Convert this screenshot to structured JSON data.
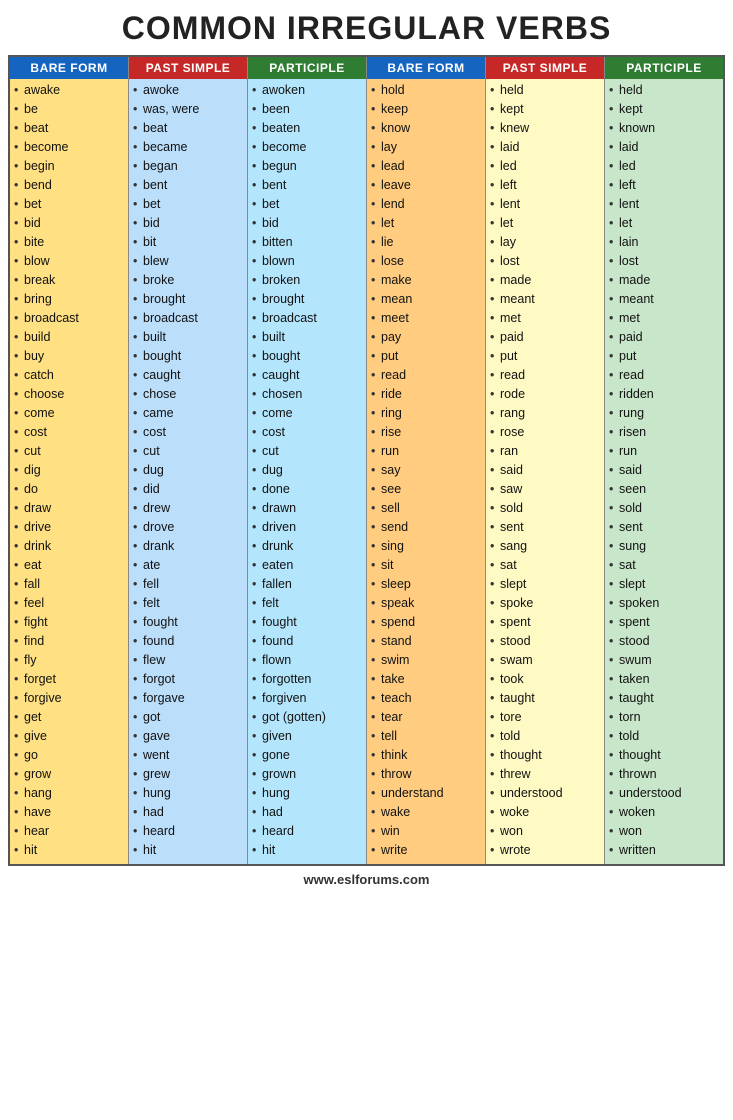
{
  "title": "COMMON IRREGULAR VERBS",
  "footer": "www.eslforums.com",
  "columns": [
    {
      "header": "BARE FORM",
      "headerClass": "blue",
      "bgClass": "bg-yellow",
      "items": [
        "awake",
        "be",
        "beat",
        "become",
        "begin",
        "bend",
        "bet",
        "bid",
        "bite",
        "blow",
        "break",
        "bring",
        "broadcast",
        "build",
        "buy",
        "catch",
        "choose",
        "come",
        "cost",
        "cut",
        "dig",
        "do",
        "draw",
        "drive",
        "drink",
        "eat",
        "fall",
        "feel",
        "fight",
        "find",
        "fly",
        "forget",
        "forgive",
        "get",
        "give",
        "go",
        "grow",
        "hang",
        "have",
        "hear",
        "hit"
      ]
    },
    {
      "header": "PAST SIMPLE",
      "headerClass": "red",
      "bgClass": "bg-blue",
      "items": [
        "awoke",
        "was, were",
        "beat",
        "became",
        "began",
        "bent",
        "bet",
        "bid",
        "bit",
        "blew",
        "broke",
        "brought",
        "broadcast",
        "built",
        "bought",
        "caught",
        "chose",
        "came",
        "cost",
        "cut",
        "dug",
        "did",
        "drew",
        "drove",
        "drank",
        "ate",
        "fell",
        "felt",
        "fought",
        "found",
        "flew",
        "forgot",
        "forgave",
        "got",
        "gave",
        "went",
        "grew",
        "hung",
        "had",
        "heard",
        "hit"
      ]
    },
    {
      "header": "PARTICIPLE",
      "headerClass": "green",
      "bgClass": "bg-lightblue",
      "items": [
        "awoken",
        "been",
        "beaten",
        "become",
        "begun",
        "bent",
        "bet",
        "bid",
        "bitten",
        "blown",
        "broken",
        "brought",
        "broadcast",
        "built",
        "bought",
        "caught",
        "chosen",
        "come",
        "cost",
        "cut",
        "dug",
        "done",
        "drawn",
        "driven",
        "drunk",
        "eaten",
        "fallen",
        "felt",
        "fought",
        "found",
        "flown",
        "forgotten",
        "forgiven",
        "got (gotten)",
        "given",
        "gone",
        "grown",
        "hung",
        "had",
        "heard",
        "hit"
      ]
    },
    {
      "header": "BARE FORM",
      "headerClass": "blue",
      "bgClass": "bg-orange",
      "items": [
        "hold",
        "keep",
        "know",
        "lay",
        "lead",
        "leave",
        "lend",
        "let",
        "lie",
        "lose",
        "make",
        "mean",
        "meet",
        "pay",
        "put",
        "read",
        "ride",
        "ring",
        "rise",
        "run",
        "say",
        "see",
        "sell",
        "send",
        "sing",
        "sit",
        "sleep",
        "speak",
        "spend",
        "stand",
        "swim",
        "take",
        "teach",
        "tear",
        "tell",
        "think",
        "throw",
        "understand",
        "wake",
        "win",
        "write"
      ]
    },
    {
      "header": "PAST SIMPLE",
      "headerClass": "red",
      "bgClass": "bg-lightyellow",
      "items": [
        "held",
        "kept",
        "knew",
        "laid",
        "led",
        "left",
        "lent",
        "let",
        "lay",
        "lost",
        "made",
        "meant",
        "met",
        "paid",
        "put",
        "read",
        "rode",
        "rang",
        "rose",
        "ran",
        "said",
        "saw",
        "sold",
        "sent",
        "sang",
        "sat",
        "slept",
        "spoke",
        "spent",
        "stood",
        "swam",
        "took",
        "taught",
        "tore",
        "told",
        "thought",
        "threw",
        "understood",
        "woke",
        "won",
        "wrote"
      ]
    },
    {
      "header": "PARTICIPLE",
      "headerClass": "green",
      "bgClass": "bg-lightgreen",
      "items": [
        "held",
        "kept",
        "known",
        "laid",
        "led",
        "left",
        "lent",
        "let",
        "lain",
        "lost",
        "made",
        "meant",
        "met",
        "paid",
        "put",
        "read",
        "ridden",
        "rung",
        "risen",
        "run",
        "said",
        "seen",
        "sold",
        "sent",
        "sung",
        "sat",
        "slept",
        "spoken",
        "spent",
        "stood",
        "swum",
        "taken",
        "taught",
        "torn",
        "told",
        "thought",
        "thrown",
        "understood",
        "woken",
        "won",
        "written"
      ]
    }
  ]
}
